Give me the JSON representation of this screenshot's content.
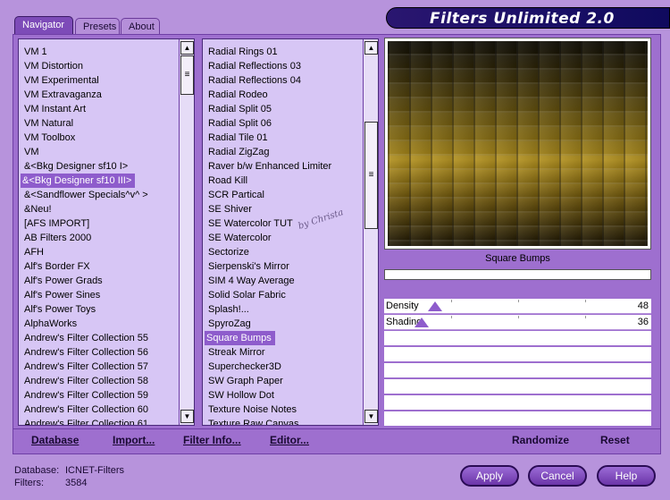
{
  "header": {
    "title": "Filters Unlimited 2.0",
    "tabs": [
      {
        "label": "Navigator",
        "active": true
      },
      {
        "label": "Presets",
        "active": false
      },
      {
        "label": "About",
        "active": false
      }
    ]
  },
  "categories": {
    "items": [
      "VM 1",
      "VM Distortion",
      "VM Experimental",
      "VM Extravaganza",
      "VM Instant Art",
      "VM Natural",
      "VM Toolbox",
      "VM",
      "&<Bkg Designer sf10 I>",
      "&<Bkg Designer sf10 III>",
      "&<Sandflower Specials^v^ >",
      "&Neu!",
      "[AFS IMPORT]",
      "AB Filters 2000",
      "AFH",
      "Alf's Border FX",
      "Alf's Power Grads",
      "Alf's Power Sines",
      "Alf's Power Toys",
      "AlphaWorks",
      "Andrew's Filter Collection 55",
      "Andrew's Filter Collection 56",
      "Andrew's Filter Collection 57",
      "Andrew's Filter Collection 58",
      "Andrew's Filter Collection 59",
      "Andrew's Filter Collection 60",
      "Andrew's Filter Collection 61"
    ],
    "selected": "&<Bkg Designer sf10 III>"
  },
  "filters": {
    "items": [
      "Radial  Rings 01",
      "Radial Reflections 03",
      "Radial Reflections 04",
      "Radial Rodeo",
      "Radial Split 05",
      "Radial Split 06",
      "Radial Tile 01",
      "Radial ZigZag",
      "Raver b/w Enhanced Limiter",
      "Road Kill",
      "SCR  Partical",
      "SE Shiver",
      "SE Watercolor TUT",
      "SE Watercolor",
      "Sectorize",
      "Sierpenski's Mirror",
      "SIM 4 Way Average",
      "Solid Solar Fabric",
      "Splash!...",
      "SpyroZag",
      "Square Bumps",
      "Streak Mirror",
      "Superchecker3D",
      "SW Graph Paper",
      "SW Hollow Dot",
      "Texture Noise Notes",
      "Texture Raw Canvas"
    ],
    "selected": "Square Bumps"
  },
  "preview": {
    "filter_name": "Square Bumps",
    "watermark": "by Christa"
  },
  "parameters": [
    {
      "label": "Density",
      "value": "48",
      "fraction": 0.19
    },
    {
      "label": "Shading",
      "value": "36",
      "fraction": 0.14
    }
  ],
  "toolbar": {
    "database": "Database",
    "import": "Import...",
    "filter_info": "Filter Info...",
    "editor": "Editor...",
    "randomize": "Randomize",
    "reset": "Reset"
  },
  "status": {
    "database_label": "Database:",
    "database_value": "ICNET-Filters",
    "filters_label": "Filters:",
    "filters_value": "3584"
  },
  "buttons": {
    "apply": "Apply",
    "cancel": "Cancel",
    "help": "Help"
  },
  "colors": {
    "panel": "#9e6fcf",
    "list_bg": "#d7c6f5",
    "selection": "#8e5ccc",
    "title_bar": "#0f0a5e"
  }
}
